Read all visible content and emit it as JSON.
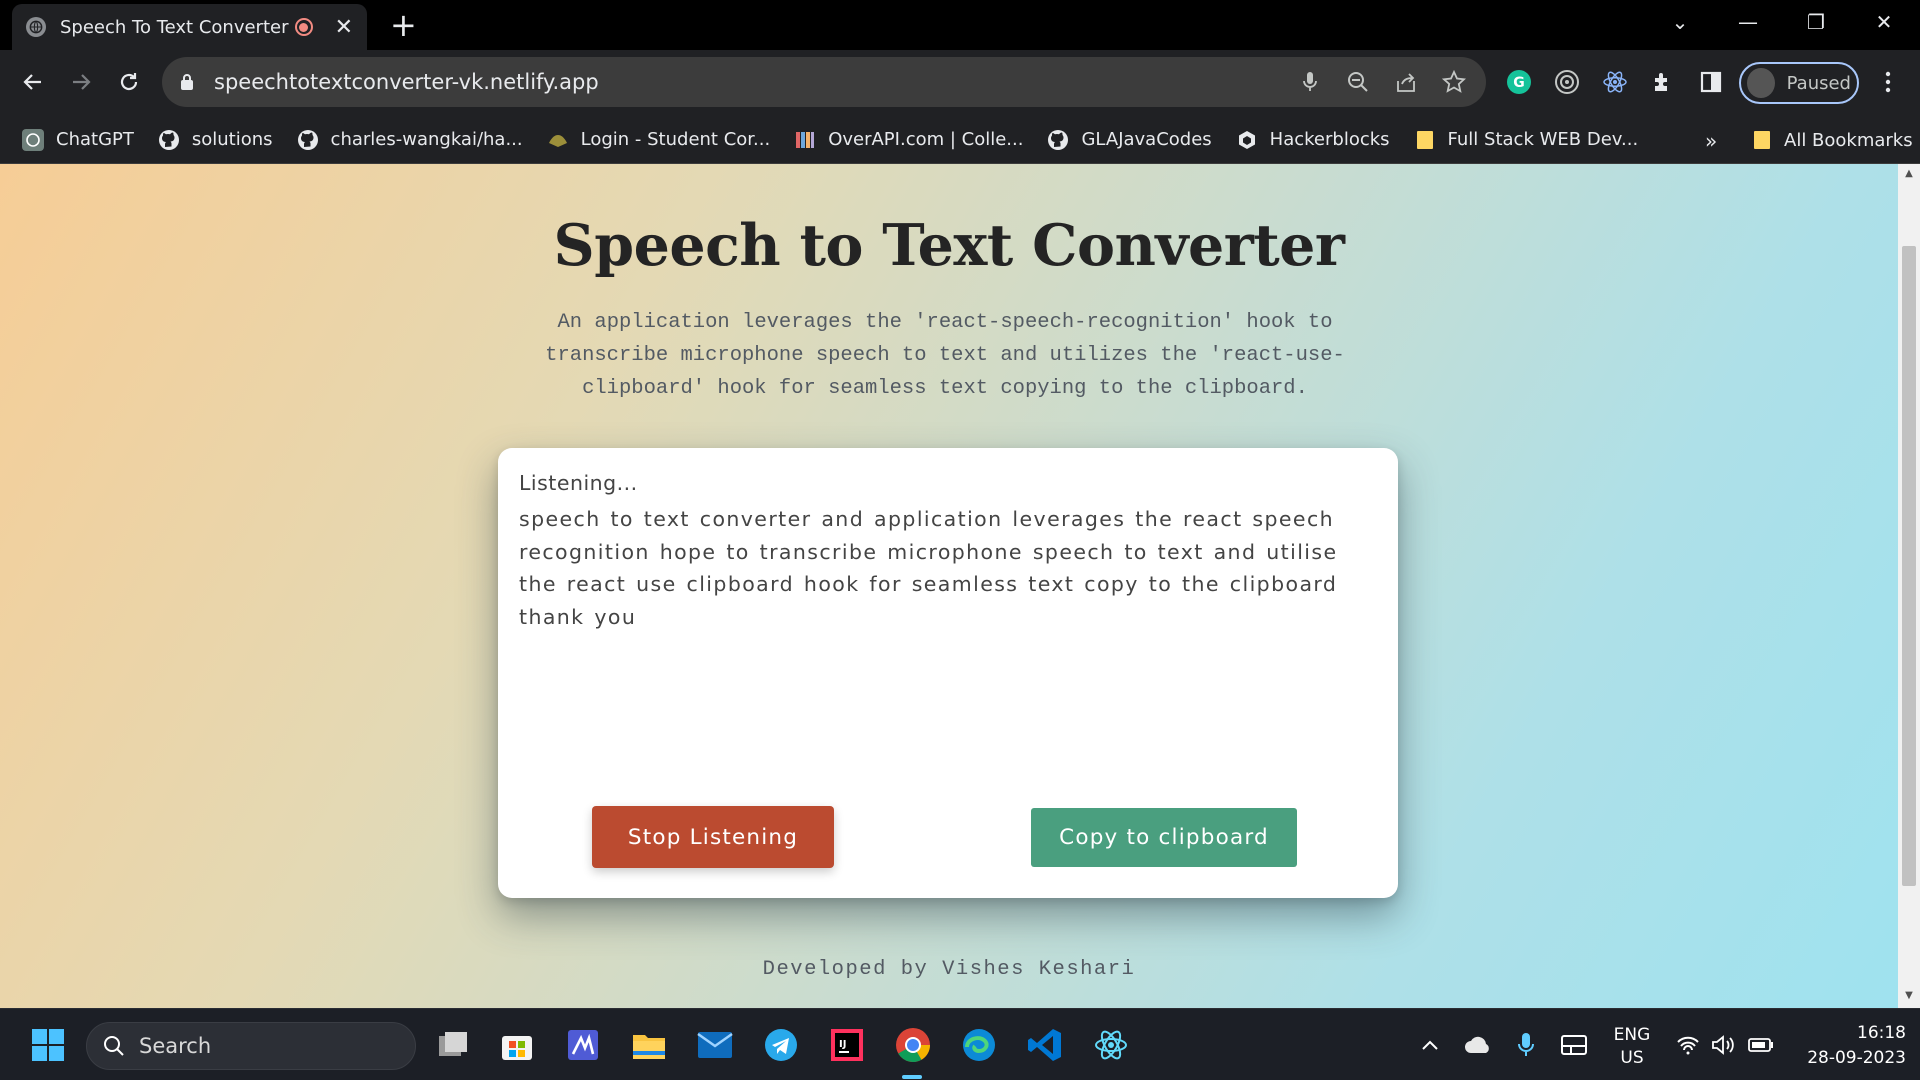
{
  "browser": {
    "tab_title": "Speech To Text Converter",
    "url": "speechtotextconverter-vk.netlify.app",
    "profile_status": "Paused"
  },
  "bookmarks": {
    "items": [
      {
        "label": "ChatGPT",
        "icon": "chatgpt-icon"
      },
      {
        "label": "solutions",
        "icon": "github-icon"
      },
      {
        "label": "charles-wangkai/ha...",
        "icon": "github-icon"
      },
      {
        "label": "Login - Student Cor...",
        "icon": "student-portal-icon"
      },
      {
        "label": "OverAPI.com | Colle...",
        "icon": "overapi-icon"
      },
      {
        "label": "GLAJavaCodes",
        "icon": "github-icon"
      },
      {
        "label": "Hackerblocks",
        "icon": "hackerblocks-icon"
      },
      {
        "label": "Full Stack WEB Dev...",
        "icon": "folder-icon"
      }
    ],
    "more": "»",
    "all_label": "All Bookmarks"
  },
  "page": {
    "title": "Speech to Text Converter",
    "subtitle": "An application leverages the 'react-speech-recognition' hook to transcribe microphone speech to text and utilizes the 'react-use-clipboard' hook for seamless text copying to the clipboard.",
    "status": "Listening...",
    "transcript": "speech to text converter and application leverages the react speech recognition hope to transcribe microphone speech to text and utilise the react use clipboard hook for seamless text copy to the clipboard thank you",
    "stop_button": "Stop Listening",
    "copy_button": "Copy to clipboard",
    "footer": "Developed by Vishes Keshari",
    "colors": {
      "stop": "#bb4b30",
      "copy": "#4a9f7f"
    }
  },
  "taskbar": {
    "search_label": "Search",
    "lang_line1": "ENG",
    "lang_line2": "US",
    "time": "16:18",
    "date": "28-09-2023"
  }
}
